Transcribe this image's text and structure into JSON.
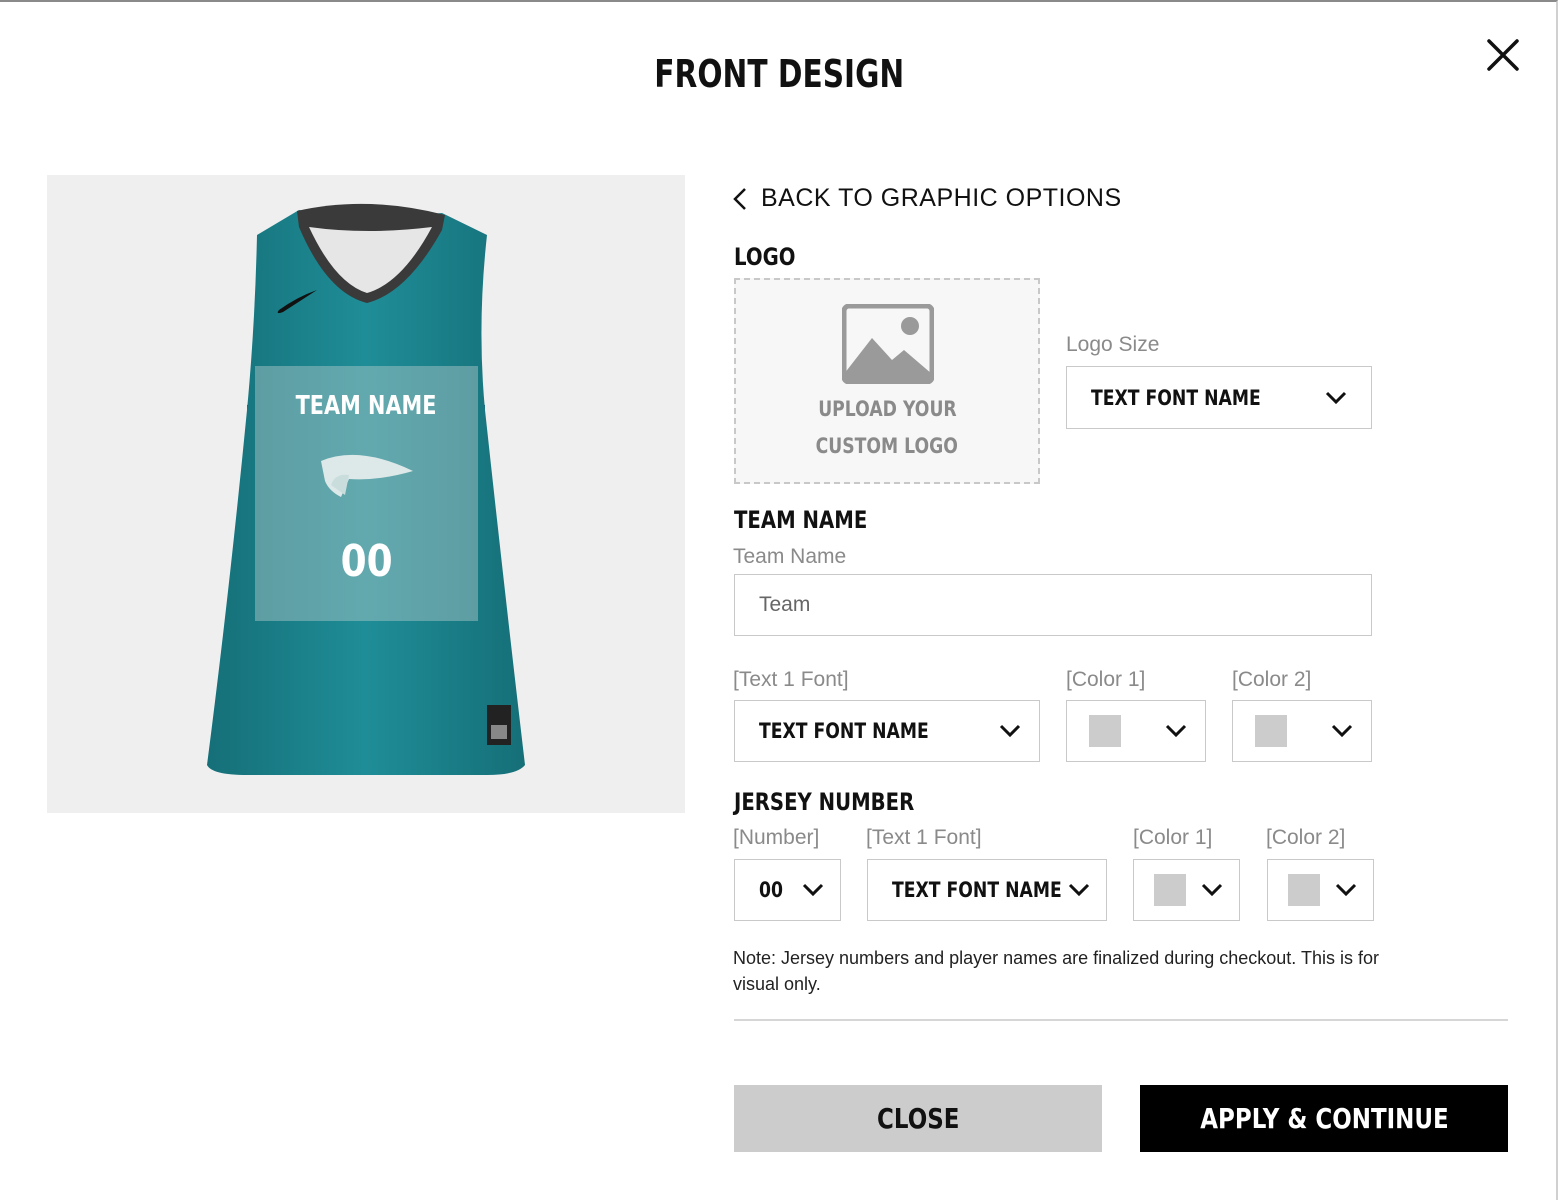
{
  "modal": {
    "title": "FRONT DESIGN",
    "close_icon": "close-icon"
  },
  "preview": {
    "team_name": "TEAM NAME",
    "number": "00",
    "jersey_color": "#1e8a93"
  },
  "back_link": {
    "label": "BACK TO GRAPHIC OPTIONS"
  },
  "logo": {
    "heading": "LOGO",
    "upload_line1": "UPLOAD YOUR",
    "upload_line2": "CUSTOM LOGO",
    "size_label": "Logo Size",
    "size_value": "TEXT FONT NAME"
  },
  "team_name": {
    "heading": "TEAM NAME",
    "field_label": "Team Name",
    "field_placeholder": "Team",
    "font_label": "[Text 1 Font]",
    "font_value": "TEXT FONT NAME",
    "color1_label": "[Color 1]",
    "color2_label": "[Color 2]"
  },
  "jersey_number": {
    "heading": "JERSEY NUMBER",
    "number_label": "[Number]",
    "number_value": "00",
    "font_label": "[Text 1 Font]",
    "font_value": "TEXT FONT NAME",
    "color1_label": "[Color 1]",
    "color2_label": "[Color 2]"
  },
  "note": "Note: Jersey numbers and player names are finalized during checkout. This is for visual only.",
  "buttons": {
    "close": "CLOSE",
    "apply": "APPLY & CONTINUE"
  }
}
